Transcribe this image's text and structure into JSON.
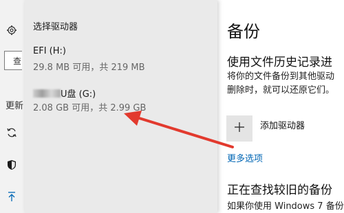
{
  "nav": {
    "search_placeholder": "查",
    "update_label": "更新"
  },
  "flyout": {
    "header": "选择驱动器",
    "drives": [
      {
        "name": "EFI (H:)",
        "detail": "29.8 MB 可用，共 219 MB"
      },
      {
        "name_suffix": "U盘 (G:)",
        "detail": "2.08 GB 可用，共 2.99 GB"
      }
    ]
  },
  "main": {
    "title": "备份",
    "section_title": "使用文件历史记录进",
    "desc_line1": "将你的文件备份到其他驱动",
    "desc_line2": "删除时，就可以还原它们。",
    "add_drive": "添加驱动器",
    "more_options": "更多选项",
    "section2_title": "正在查找较旧的备份",
    "section2_desc": "如果你使用 Windows 7 备份"
  },
  "annotation": {
    "arrow_color": "#e23a2e"
  }
}
